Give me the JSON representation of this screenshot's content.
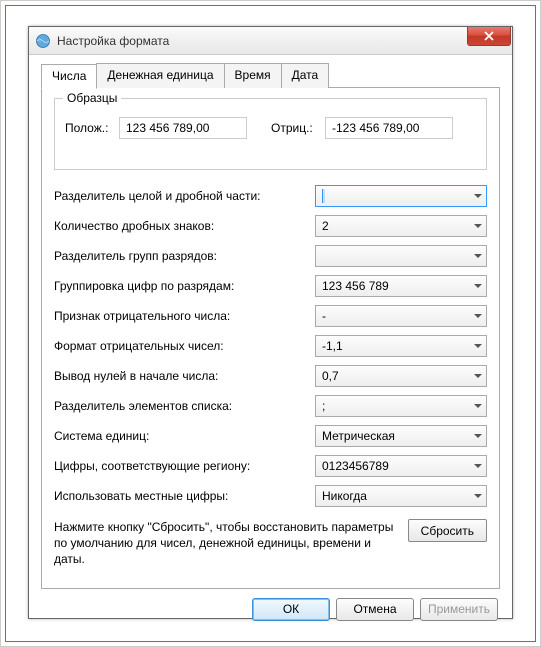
{
  "window": {
    "title": "Настройка формата"
  },
  "tabs": {
    "numbers": "Числа",
    "currency": "Денежная единица",
    "time": "Время",
    "date": "Дата"
  },
  "samples": {
    "legend": "Образцы",
    "positive_label": "Полож.:",
    "positive_value": "123 456 789,00",
    "negative_label": "Отриц.:",
    "negative_value": "-123 456 789,00"
  },
  "fields": {
    "decimal_sep": {
      "label": "Разделитель целой и дробной части:",
      "value": ""
    },
    "decimal_digits": {
      "label": "Количество дробных знаков:",
      "value": "2"
    },
    "group_sep": {
      "label": "Разделитель групп разрядов:",
      "value": ""
    },
    "grouping": {
      "label": "Группировка цифр по разрядам:",
      "value": "123 456 789"
    },
    "neg_sign": {
      "label": "Признак отрицательного числа:",
      "value": "-"
    },
    "neg_format": {
      "label": "Формат отрицательных чисел:",
      "value": "-1,1"
    },
    "leading_zero": {
      "label": "Вывод нулей в начале числа:",
      "value": "0,7"
    },
    "list_sep": {
      "label": "Разделитель элементов списка:",
      "value": ";"
    },
    "measure": {
      "label": "Система единиц:",
      "value": "Метрическая"
    },
    "native_digits": {
      "label": "Цифры, соответствующие региону:",
      "value": "0123456789"
    },
    "use_native": {
      "label": "Использовать местные цифры:",
      "value": "Никогда"
    }
  },
  "reset": {
    "text": "Нажмите кнопку \"Сбросить\", чтобы восстановить параметры по умолчанию для чисел, денежной единицы, времени и даты.",
    "button": "Сбросить"
  },
  "footer": {
    "ok": "ОК",
    "cancel": "Отмена",
    "apply": "Применить"
  }
}
